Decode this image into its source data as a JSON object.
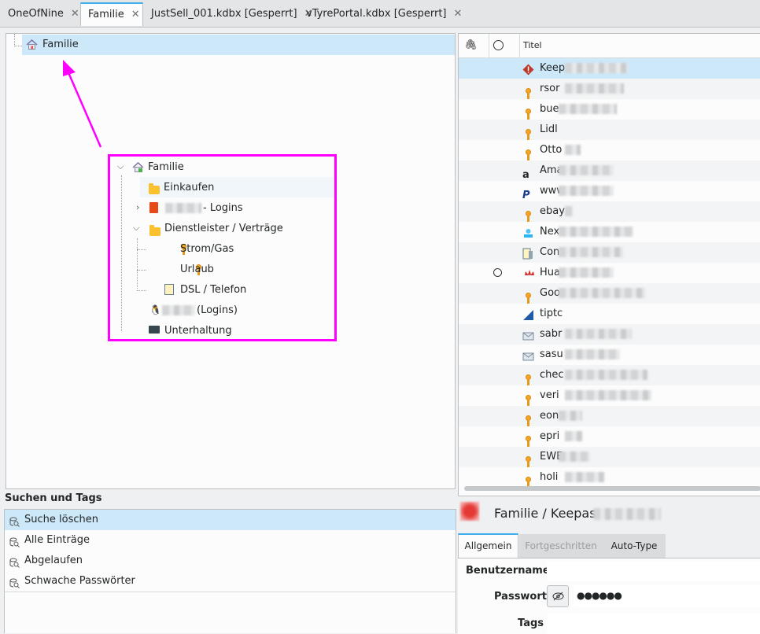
{
  "tabs": [
    {
      "label": "OneOfNine",
      "active": false
    },
    {
      "label": "Familie",
      "active": true
    },
    {
      "label": "JustSell_001.kdbx [Gesperrt]",
      "active": false
    },
    {
      "label": "vTyrePortal.kdbx [Gesperrt]",
      "active": false
    }
  ],
  "tree": {
    "root": "Familie",
    "inset_root": "Familie",
    "einkaufen": "Einkaufen",
    "logins": "- Logins",
    "dienstleister": "Dienstleister / Verträge",
    "strom": "Strom/Gas",
    "urlaub": "Urlaub",
    "dsl": "DSL / Telefon",
    "logins2": "(Logins)",
    "unterhaltung": "Unterhaltung"
  },
  "search": {
    "header": "Suchen und Tags",
    "items": [
      "Suche löschen",
      "Alle Einträge",
      "Abgelaufen",
      "Schwache Passwörter"
    ]
  },
  "entries": {
    "col_title": "Titel",
    "rows": [
      {
        "t": "Keep",
        "icon": "warning"
      },
      {
        "t": "rsor",
        "icon": "key"
      },
      {
        "t": "bue",
        "icon": "key"
      },
      {
        "t": "Lidl",
        "icon": "key"
      },
      {
        "t": "Otto",
        "icon": "key"
      },
      {
        "t": "Ama",
        "icon": "amazon"
      },
      {
        "t": "www",
        "icon": "paypal"
      },
      {
        "t": "ebay",
        "icon": "key"
      },
      {
        "t": "Nex",
        "icon": "network"
      },
      {
        "t": "Con",
        "icon": "phone"
      },
      {
        "t": "Hua",
        "icon": "huawei",
        "clock": true
      },
      {
        "t": "Goo",
        "icon": "key"
      },
      {
        "t": "tiptc",
        "icon": "triangle"
      },
      {
        "t": "sabr",
        "icon": "mail"
      },
      {
        "t": "sasu",
        "icon": "mail"
      },
      {
        "t": "chec",
        "icon": "key"
      },
      {
        "t": "veri",
        "icon": "key"
      },
      {
        "t": "eon",
        "icon": "key"
      },
      {
        "t": "epri",
        "icon": "key"
      },
      {
        "t": "EWE",
        "icon": "key"
      },
      {
        "t": "holi",
        "icon": "key"
      }
    ]
  },
  "detail": {
    "title": "Familie / Keepass",
    "tabs": [
      "Allgemein",
      "Fortgeschritten",
      "Auto-Type"
    ],
    "username_label": "Benutzername",
    "password_label": "Passwort",
    "password_value": "●●●●●●",
    "tags_label": "Tags"
  },
  "colors": {
    "accent": "#3daee9",
    "selection": "#cde8f9",
    "annotation": "#ff00ff"
  }
}
